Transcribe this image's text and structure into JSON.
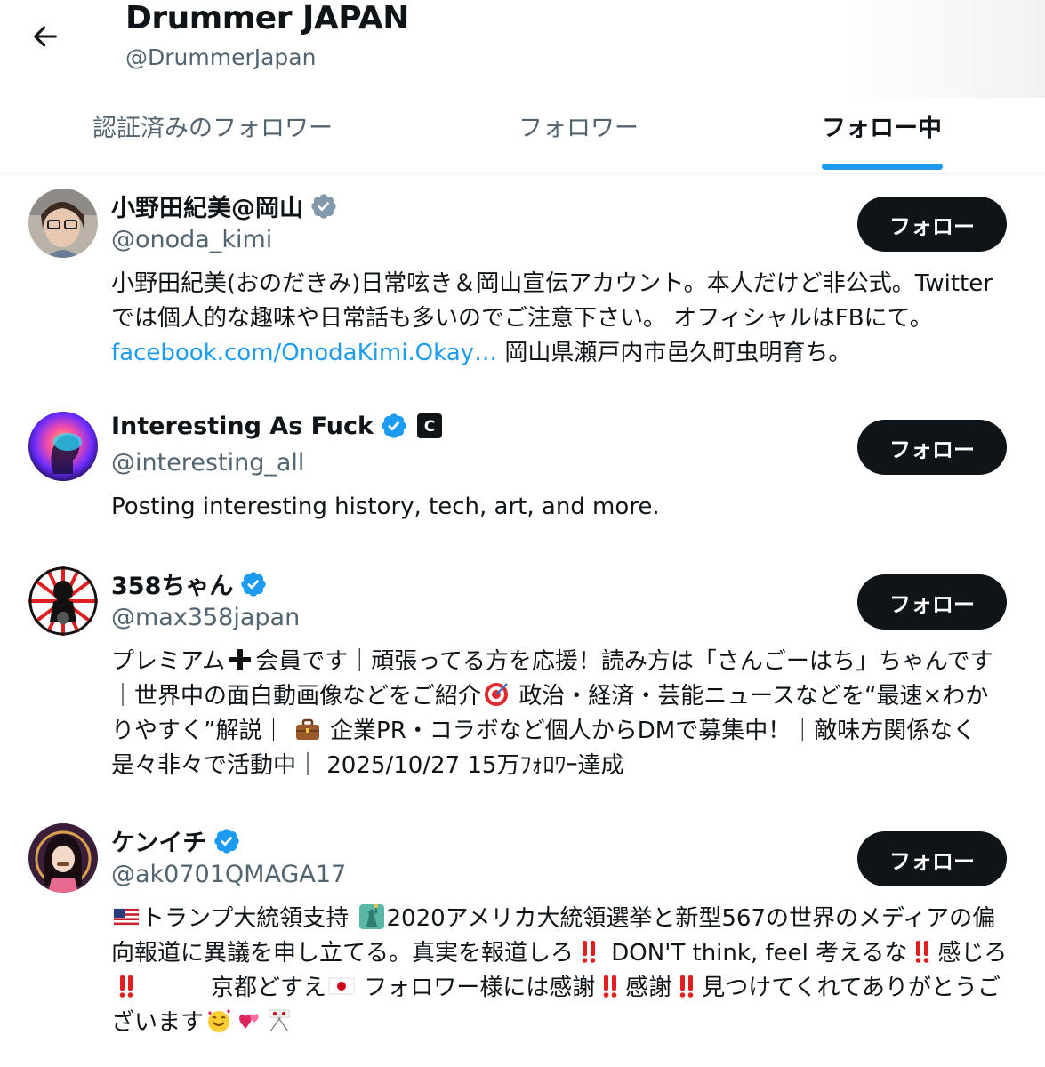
{
  "header": {
    "title": "Drummer JAPAN",
    "handle": "@DrummerJapan"
  },
  "tabs": [
    {
      "label": "認証済みのフォロワー",
      "active": false
    },
    {
      "label": "フォロワー",
      "active": false
    },
    {
      "label": "フォロー中",
      "active": true
    }
  ],
  "users": [
    {
      "name": "小野田紀美@岡山",
      "handle": "@onoda_kimi",
      "badge": "gray-check",
      "follow_label": "フォロー",
      "bio_part1": "小野田紀美(おのだきみ)日常呟き＆岡山宣伝アカウント。本人だけど非公式。Twitterでは個人的な趣味や日常話も多いのでご注意下さい。 オフィシャルはFBにて。",
      "bio_link": "facebook.com/OnodaKimi.Okay…",
      "bio_part2": " 岡山県瀬戸内市邑久町虫明育ち。"
    },
    {
      "name": "Interesting As Fuck",
      "handle": "@interesting_all",
      "badge": "blue-check",
      "affiliate": "C",
      "follow_label": "フォロー",
      "bio": "Posting interesting history, tech, art, and more."
    },
    {
      "name": "358ちゃん",
      "handle": "@max358japan",
      "badge": "blue-check",
      "follow_label": "フォロー",
      "bio_p1": "プレミアム",
      "bio_p2": "会員です｜頑張ってる方を応援！読み方は「さんごーはち」ちゃんです｜世界中の面白動画像などをご紹介",
      "bio_p3": " 政治・経済・芸能ニュースなどを“最速×わかりやすく”解説｜ ",
      "bio_p4": " 企業PR・コラボなど個人からDMで募集中！｜敵味方関係なく是々非々で活動中｜ 2025/10/27 15万ﾌｫﾛﾜｰ達成"
    },
    {
      "name": "ケンイチ",
      "handle": "@ak0701QMAGA17",
      "badge": "blue-check",
      "follow_label": "フォロー",
      "bio_p1": "トランプ大統領支持 ",
      "bio_p2": "2020アメリカ大統領選挙と新型567の世界のメディアの偏向報道に異議を申し立てる。真実を報道しろ",
      "bio_p3": " DON'T think, feel 考えるな",
      "bio_p4": "感じろ",
      "bio_p5": "　　　京都どすえ",
      "bio_p6": " フォロワー様には感謝",
      "bio_p7": "感謝",
      "bio_p8": "見つけてくれてありがとうございます"
    }
  ],
  "colors": {
    "accent": "#1d9bf0",
    "text": "#0f1419",
    "secondary": "#536471",
    "button": "#0f1419",
    "gray_badge": "#829aab"
  }
}
